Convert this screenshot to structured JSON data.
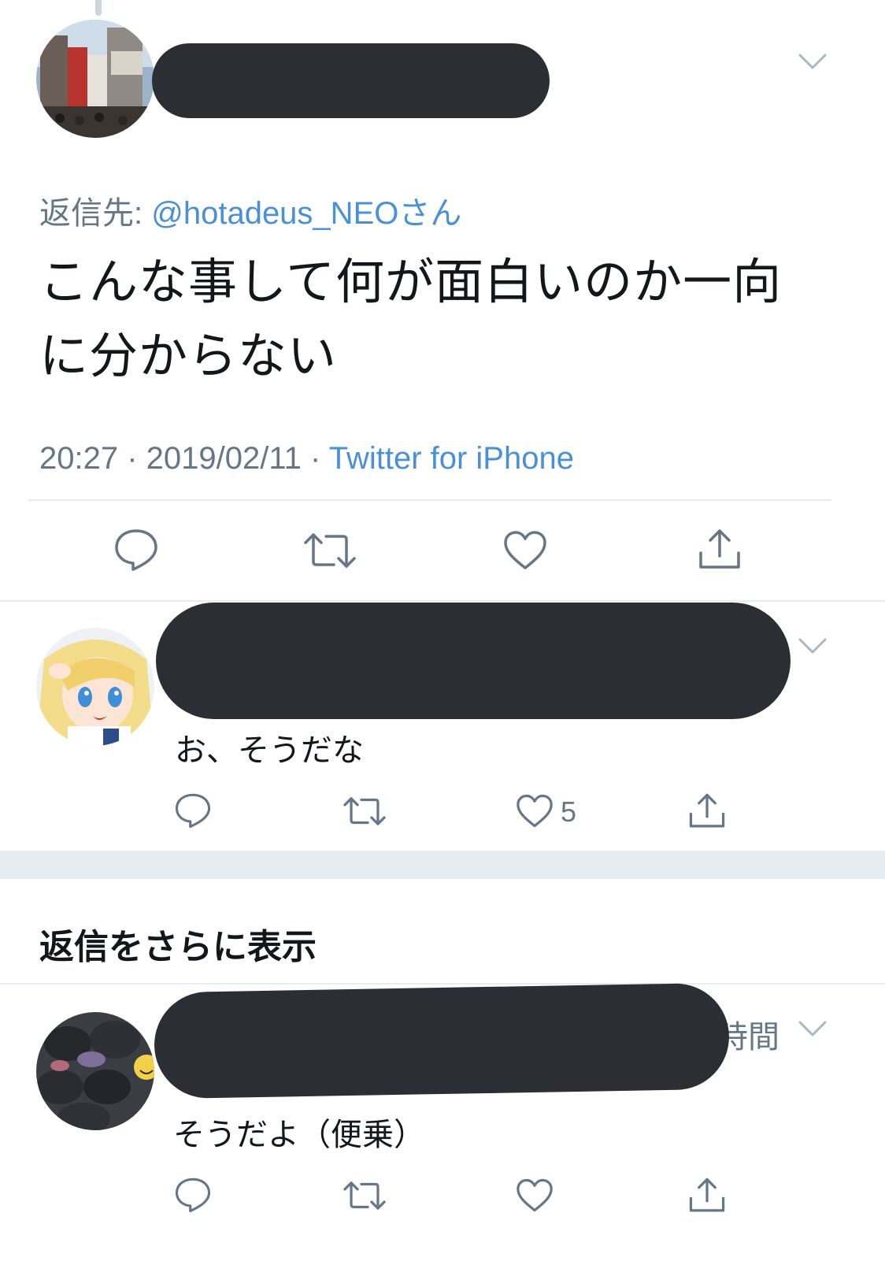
{
  "main_tweet": {
    "reply_to_prefix": "返信先: ",
    "reply_to_handle": "@hotadeus_NEOさん",
    "text_line1": "こんな事して何が面白いのか一向",
    "text_line2": "に分からない",
    "time": "20:27",
    "sep": " · ",
    "date": "2019/02/11",
    "source": "Twitter for iPhone"
  },
  "reply1": {
    "text": "お、そうだな",
    "likes": "5"
  },
  "more_replies_label": "返信をさらに表示",
  "reply2": {
    "time_partial": "時間",
    "text": "そうだよ（便乗）"
  },
  "colors": {
    "link": "#4a90d9",
    "muted": "#657786",
    "redaction": "#2b2e33",
    "divider": "#e6ecf0"
  }
}
